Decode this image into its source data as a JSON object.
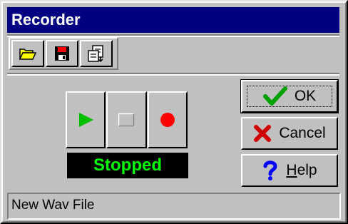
{
  "window": {
    "title": "Recorder"
  },
  "toolbar": {
    "buttons": [
      {
        "icon": "folder-open-icon"
      },
      {
        "icon": "floppy-disk-icon"
      },
      {
        "icon": "insert-file-icon"
      }
    ]
  },
  "transport": {
    "buttons": [
      {
        "icon": "play-icon",
        "color": "#00c000"
      },
      {
        "icon": "stop-icon",
        "color": "#c0c0c0"
      },
      {
        "icon": "record-icon",
        "color": "#ff0000"
      }
    ],
    "status_text": "Stopped",
    "status_color": "#00ff00"
  },
  "dialog_buttons": {
    "ok_label": "OK",
    "cancel_label": "Cancel",
    "help_label_accel": "H",
    "help_label_rest": "elp"
  },
  "statusbar": {
    "text": "New Wav File"
  },
  "colors": {
    "titlebar": "#000080",
    "face": "#c0c0c0"
  }
}
